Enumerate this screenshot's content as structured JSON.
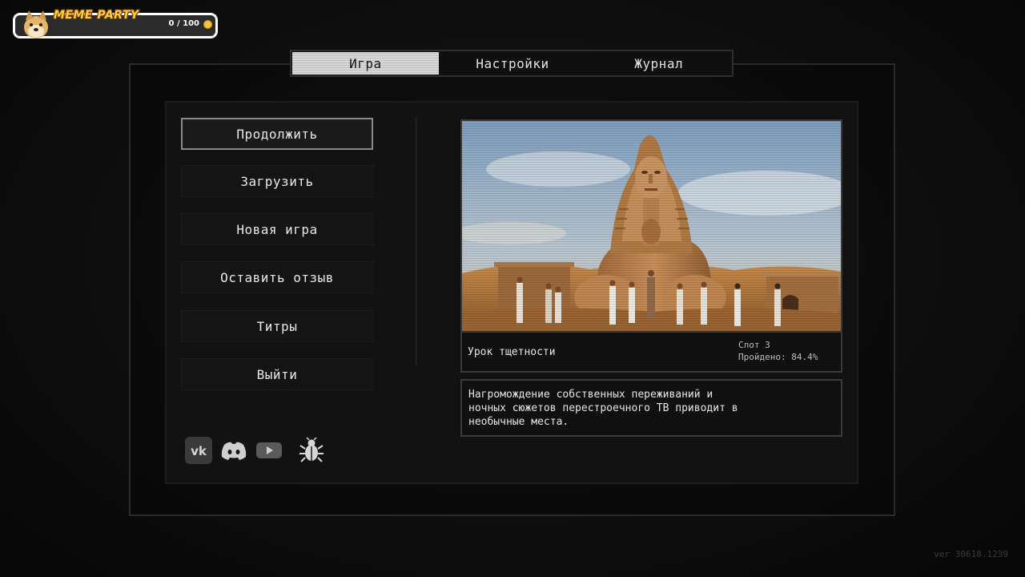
{
  "badge": {
    "title": "MEME PARTY",
    "coins": "0 / 100",
    "icon": "doge-icon"
  },
  "tabs": [
    {
      "label": "Игра",
      "active": true
    },
    {
      "label": "Настройки",
      "active": false
    },
    {
      "label": "Журнал",
      "active": false
    }
  ],
  "menu": {
    "continue": "Продолжить",
    "load": "Загрузить",
    "new_game": "Новая игра",
    "feedback": "Оставить отзыв",
    "credits": "Титры",
    "exit": "Выйти"
  },
  "social": [
    "vk-icon",
    "discord-icon",
    "youtube-icon",
    "bug-report-icon"
  ],
  "save": {
    "name": "Урок тщетности",
    "slot": "Слот 3",
    "progress": "Пройдено: 84.4%",
    "description": "Нагромождение собственных переживаний и\nночных сюжетов перестроечного ТВ приводит в\nнеобычные места."
  },
  "version": "ver 30618.1239",
  "colors": {
    "accent_gold": "#ffd13b",
    "tab_active_bg": "#d9d9d9",
    "panel_bg": "#121212"
  }
}
